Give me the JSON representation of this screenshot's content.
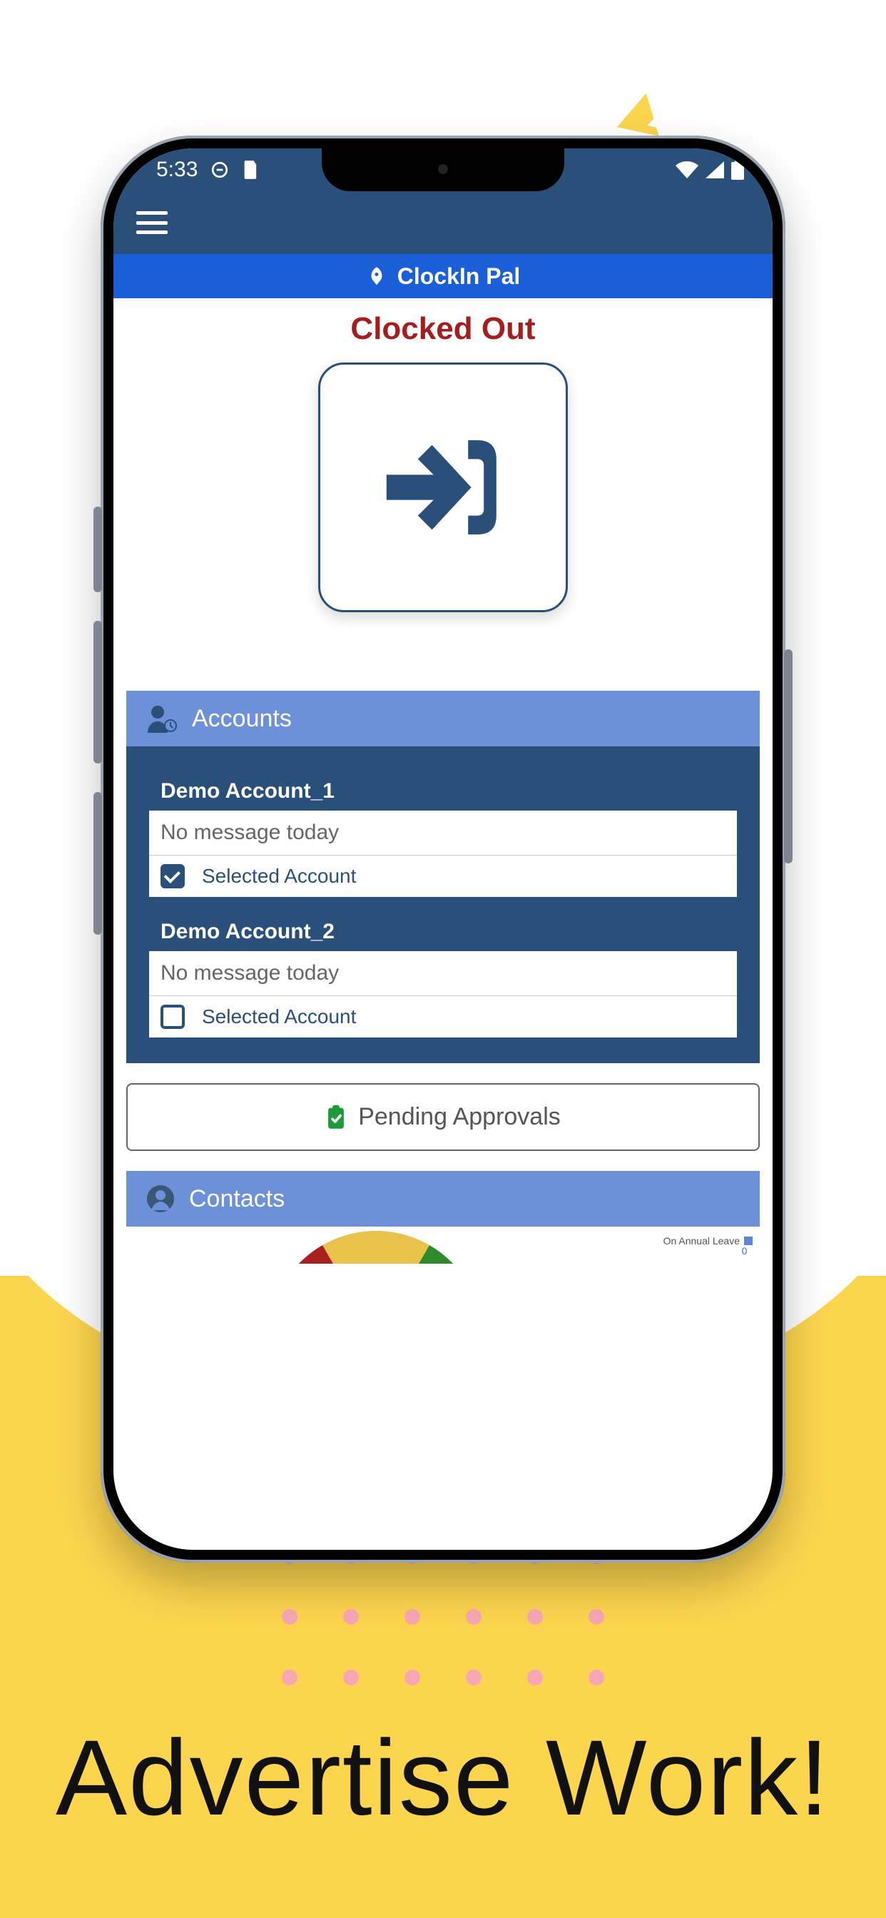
{
  "status_bar": {
    "time": "5:33"
  },
  "app": {
    "title": "ClockIn Pal",
    "clock_status": "Clocked Out"
  },
  "sections": {
    "accounts_label": "Accounts",
    "contacts_label": "Contacts"
  },
  "accounts": [
    {
      "name": "Demo Account_1",
      "message": "No message today",
      "selected_label": "Selected Account",
      "checked": true
    },
    {
      "name": "Demo Account_2",
      "message": "No message today",
      "selected_label": "Selected Account",
      "checked": false
    }
  ],
  "pending_approvals_label": "Pending Approvals",
  "legend": {
    "label": "On Annual Leave",
    "value": "0"
  },
  "headline": "Advertise Work!"
}
